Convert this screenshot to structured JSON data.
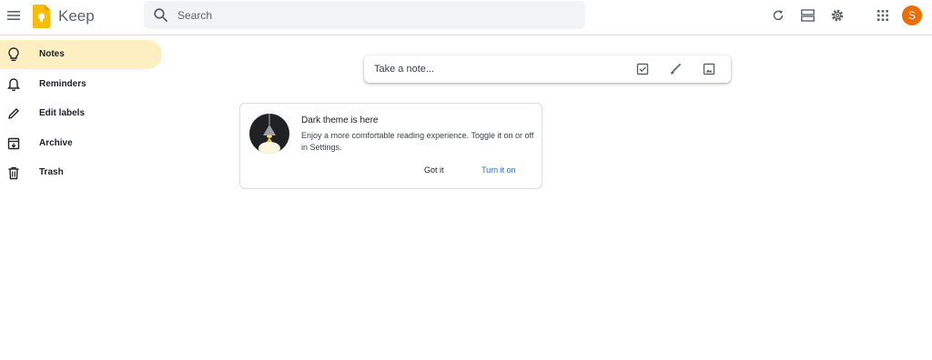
{
  "header": {
    "app_name": "Keep",
    "search_placeholder": "Search",
    "avatar_letter": "S",
    "icons": [
      "main-menu-icon",
      "keep-logo-icon",
      "search-icon",
      "refresh-icon",
      "list-view-icon",
      "settings-icon",
      "apps-grid-icon"
    ]
  },
  "sidebar": {
    "items": [
      {
        "label": "Notes",
        "icon": "lightbulb-icon",
        "active": true
      },
      {
        "label": "Reminders",
        "icon": "bell-icon"
      },
      {
        "label": "Edit labels",
        "icon": "pencil-icon"
      },
      {
        "label": "Archive",
        "icon": "archive-icon"
      },
      {
        "label": "Trash",
        "icon": "trash-icon"
      }
    ]
  },
  "note_input": {
    "placeholder": "Take a note...",
    "icons": [
      "checkbox-icon",
      "brush-icon",
      "image-icon"
    ]
  },
  "dark_theme_card": {
    "title": "Dark theme is here",
    "body": "Enjoy a more comfortable reading experience. Toggle it on or off in Settings.",
    "dismiss_label": "Got it",
    "action_label": "Turn it on"
  },
  "colors": {
    "active_nav": "#feefc3",
    "accent_blue": "#1a73e8",
    "avatar": "#ef6c00",
    "logo_yellow": "#fbbc04"
  }
}
